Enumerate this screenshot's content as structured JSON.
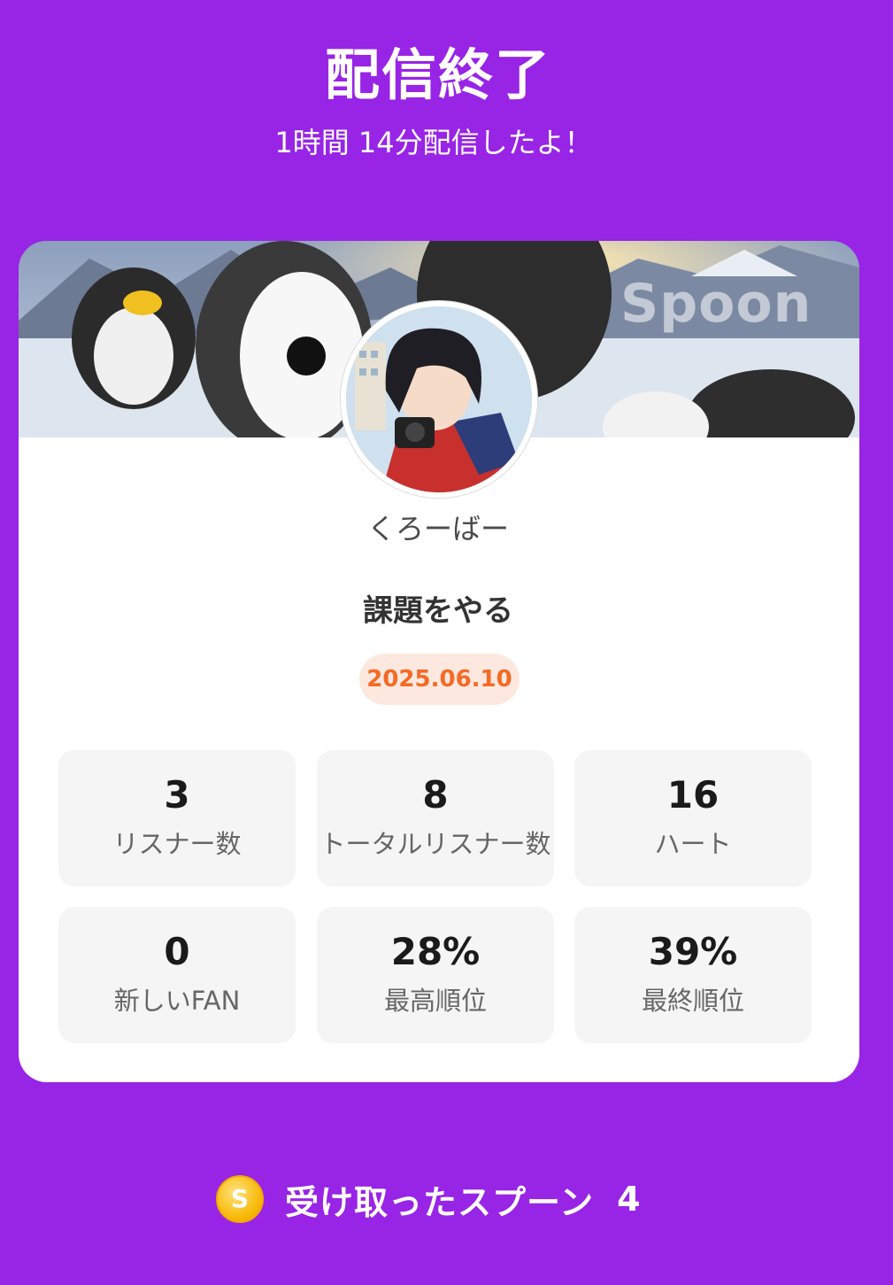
{
  "header": {
    "title": "配信終了",
    "subtitle": "1時間 14分配信したよ！"
  },
  "card": {
    "cover_watermark": "Spoon",
    "username": "くろーばー",
    "stream_title": "課題をやる",
    "date": "2025.06.10"
  },
  "stats": [
    {
      "value": "3",
      "label": "リスナー数"
    },
    {
      "value": "8",
      "label": "トータルリスナー数"
    },
    {
      "value": "16",
      "label": "ハート"
    },
    {
      "value": "0",
      "label": "新しいFAN"
    },
    {
      "value": "28%",
      "label": "最高順位"
    },
    {
      "value": "39%",
      "label": "最終順位"
    }
  ],
  "spoons": {
    "coin_symbol": "S",
    "label": "受け取ったスプーン",
    "count": "4"
  },
  "colors": {
    "background": "#9824e6",
    "card": "#ffffff",
    "date_text": "#f46a24",
    "date_bg": "#fde8e0",
    "stat_bg": "#f5f5f5"
  }
}
